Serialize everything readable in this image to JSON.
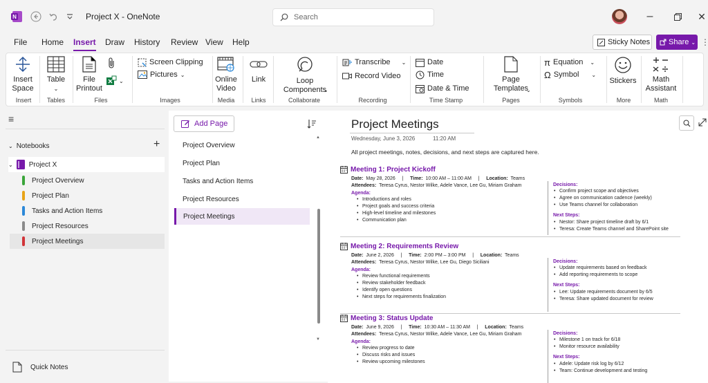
{
  "titlebar": {
    "app_title": "Project X - OneNote",
    "search_placeholder": "Search",
    "undo_icon": "undo-icon",
    "back_icon": "back-icon"
  },
  "menu": {
    "tabs": [
      "File",
      "Home",
      "Insert",
      "Draw",
      "History",
      "Review",
      "View",
      "Help"
    ],
    "active": "Insert",
    "sticky_notes": "Sticky Notes",
    "share": "Share"
  },
  "ribbon": {
    "insert_space": "Insert\nSpace",
    "table": "Table",
    "file_printout": "File\nPrintout",
    "screen_clipping": "Screen Clipping",
    "pictures": "Pictures",
    "online_video": "Online\nVideo",
    "link": "Link",
    "loop_components": "Loop\nComponents",
    "transcribe": "Transcribe",
    "record_video": "Record Video",
    "date": "Date",
    "time": "Time",
    "date_time": "Date & Time",
    "page_templates": "Page\nTemplates",
    "equation": "Equation",
    "symbol": "Symbol",
    "stickers": "Stickers",
    "math_assistant": "Math\nAssistant",
    "groups": {
      "insert": "Insert",
      "tables": "Tables",
      "files": "Files",
      "images": "Images",
      "media": "Media",
      "links": "Links",
      "collaborate": "Collaborate",
      "recording": "Recording",
      "time_stamp": "Time Stamp",
      "pages": "Pages",
      "symbols": "Symbols",
      "more": "More",
      "math": "Math"
    }
  },
  "nav": {
    "notebooks_label": "Notebooks",
    "notebook": "Project X",
    "sections": [
      {
        "label": "Project Overview",
        "color": "#3aa53a"
      },
      {
        "label": "Project Plan",
        "color": "#e8a317"
      },
      {
        "label": "Tasks and Action Items",
        "color": "#2b88d8"
      },
      {
        "label": "Project Resources",
        "color": "#8a8a8a"
      },
      {
        "label": "Project Meetings",
        "color": "#d13438"
      }
    ],
    "quick_notes": "Quick Notes"
  },
  "pages": {
    "add_page": "Add Page",
    "items": [
      "Project Overview",
      "Project Plan",
      "Tasks and Action Items",
      "Project Resources",
      "Project Meetings"
    ]
  },
  "note": {
    "title": "Project Meetings",
    "date": "Wednesday, June 3, 2026",
    "time": "11:20 AM",
    "intro": "All project meetings, notes, decisions, and next steps are captured here.",
    "meetings": [
      {
        "title": "Meeting 1: Project Kickoff",
        "date_line": "May 28, 2026",
        "time_line": "10:00 AM – 11:00 AM",
        "location": "Teams",
        "attendees": "Teresa Cyrus, Nestor Wilke, Adele Vance, Lee Gu, Miriam Graham",
        "agenda": [
          "Introductions and roles",
          "Project goals and success criteria",
          "High-level timeline and milestones",
          "Communication plan"
        ],
        "decisions": [
          "Confirm project scope and objectives",
          "Agree on communication cadence (weekly)",
          "Use Teams channel for collaboration"
        ],
        "next_steps": [
          "Nestor: Share project timeline draft by 6/1",
          "Teresa: Create Teams channel and SharePoint site"
        ]
      },
      {
        "title": "Meeting 2: Requirements Review",
        "date_line": "June 2, 2026",
        "time_line": "2:00 PM – 3:00 PM",
        "location": "Teams",
        "attendees": "Teresa Cyrus, Nestor Wilke, Lee Gu, Diego Siciliani",
        "agenda": [
          "Review functional requirements",
          "Review stakeholder feedback",
          "Identify open questions",
          "Next steps for requirements finalization"
        ],
        "decisions": [
          "Update requirements based on feedback",
          "Add reporting requirements to scope"
        ],
        "next_steps": [
          "Lee: Update requirements document by 6/5",
          "Teresa: Share updated document for review"
        ]
      },
      {
        "title": "Meeting 3: Status Update",
        "date_line": "June 9, 2026",
        "time_line": "10:30 AM – 11:30 AM",
        "location": "Teams",
        "attendees": "Teresa Cyrus, Nestor Wilke, Adele Vance, Lee Gu, Miriam Graham",
        "agenda": [
          "Review progress to date",
          "Discuss risks and issues",
          "Review upcoming milestones"
        ],
        "decisions": [
          "Milestone 1 on track for 6/18",
          "Monitor resource availability"
        ],
        "next_steps": [
          "Adele: Update risk log by 6/12",
          "Team: Continue development and testing"
        ]
      }
    ],
    "labels": {
      "date": "Date:",
      "time": "Time:",
      "location": "Location:",
      "attendees": "Attendees:",
      "agenda": "Agenda:",
      "decisions": "Decisions:",
      "next_steps": "Next Steps:"
    }
  }
}
